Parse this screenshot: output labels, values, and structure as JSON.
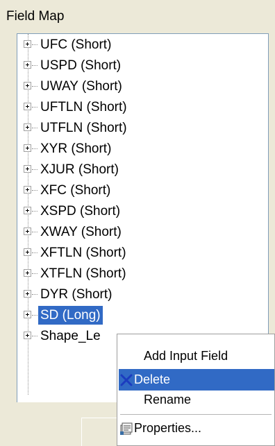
{
  "panel": {
    "title": "Field Map"
  },
  "tree": {
    "items": [
      {
        "label": "UFC (Short)"
      },
      {
        "label": "USPD (Short)"
      },
      {
        "label": "UWAY (Short)"
      },
      {
        "label": "UFTLN (Short)"
      },
      {
        "label": "UTFLN (Short)"
      },
      {
        "label": "XYR (Short)"
      },
      {
        "label": "XJUR (Short)"
      },
      {
        "label": "XFC (Short)"
      },
      {
        "label": "XSPD (Short)"
      },
      {
        "label": "XWAY (Short)"
      },
      {
        "label": "XFTLN (Short)"
      },
      {
        "label": "XTFLN (Short)"
      },
      {
        "label": "DYR (Short)"
      },
      {
        "label": "SD (Long)",
        "selected": true
      },
      {
        "label": "Shape_Le"
      }
    ]
  },
  "context_menu": {
    "add_input_field": "Add Input Field",
    "delete": "Delete",
    "rename": "Rename",
    "properties": "Properties..."
  },
  "colors": {
    "selection": "#316ac5",
    "window_bg": "#ece9d8",
    "delete_icon": "#1b3cbf"
  }
}
